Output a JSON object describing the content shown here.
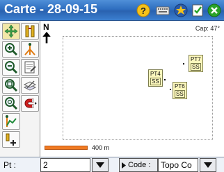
{
  "title": "Carte - 28-09-15",
  "titlebar_icons": [
    "help-icon",
    "keyboard-icon",
    "star-icon",
    "checklist-icon",
    "close-icon"
  ],
  "colors": {
    "titlebar": "#2f6fc0",
    "point_label_bg": "#fbf6bc",
    "scalebar": "#f07a22",
    "close": "#2aa32a"
  },
  "map": {
    "north_label": "N",
    "cap_label": "Cap: 47°",
    "points": [
      {
        "name": "PT7",
        "code": "SS"
      },
      {
        "name": "PT4",
        "code": "SS"
      },
      {
        "name": "PT6",
        "code": "SS"
      }
    ],
    "scale_label": "400 m"
  },
  "sidebar": {
    "tools": [
      "pan-icon",
      "survey-pole-icon",
      "zoom-in-icon",
      "stakeout-icon",
      "zoom-out-icon",
      "notes-icon",
      "zoom-window-icon",
      "layers-icon",
      "zoom-extents-icon",
      "magnet-icon",
      "profile-icon",
      "add-point-icon"
    ]
  },
  "bottom": {
    "pt_label": "Pt :",
    "pt_value": "2",
    "code_button": "Code :",
    "code_value": "Topo Co"
  }
}
